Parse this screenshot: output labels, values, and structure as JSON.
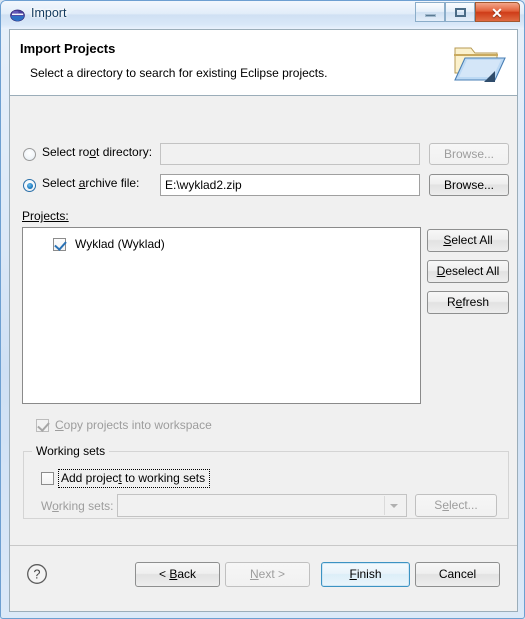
{
  "window": {
    "title": "Import",
    "icon": "eclipse-icon",
    "controls": {
      "minimize": "minimize-icon",
      "maximize": "maximize-icon",
      "close": "✕"
    }
  },
  "header": {
    "title": "Import Projects",
    "description": "Select a directory to search for existing Eclipse projects.",
    "icon": "open-folder-icon"
  },
  "source": {
    "root_directory": {
      "label": "Select root directory:",
      "underline_char": "o",
      "selected": false,
      "value": "",
      "enabled": false,
      "browse_label": "Browse...",
      "browse_enabled": false
    },
    "archive_file": {
      "label": "Select archive file:",
      "underline_char": "a",
      "selected": true,
      "value": "E:\\wyklad2.zip",
      "enabled": true,
      "browse_label": "Browse...",
      "browse_enabled": true
    }
  },
  "projects": {
    "label": "Projects:",
    "items": [
      {
        "label": "Wyklad (Wyklad)",
        "checked": true
      }
    ],
    "buttons": {
      "select_all": "Select All",
      "deselect_all": "Deselect All",
      "refresh": "Refresh"
    }
  },
  "options": {
    "copy_projects": {
      "label": "Copy projects into workspace",
      "checked": true,
      "enabled": false
    }
  },
  "working_sets": {
    "group_label": "Working sets",
    "add_checkbox": {
      "label": "Add project to working sets",
      "checked": false,
      "focused": true
    },
    "combo_label": "Working sets:",
    "combo_value": "",
    "combo_enabled": false,
    "select_button": "Select...",
    "select_enabled": false
  },
  "footer": {
    "help_icon": "help-icon",
    "buttons": {
      "back": "< Back",
      "next": "Next >",
      "finish": "Finish",
      "cancel": "Cancel"
    },
    "back_enabled": true,
    "next_enabled": false,
    "finish_is_default": true
  },
  "colors": {
    "titlebar_text": "#123a5e",
    "close_button": "#cf3c18",
    "default_button_border": "#3c93c2",
    "radio_accent": "#1f7cc2",
    "check_accent": "#2a72b5",
    "dialog_background": "#f0f0f0",
    "field_background": "#ffffff"
  }
}
